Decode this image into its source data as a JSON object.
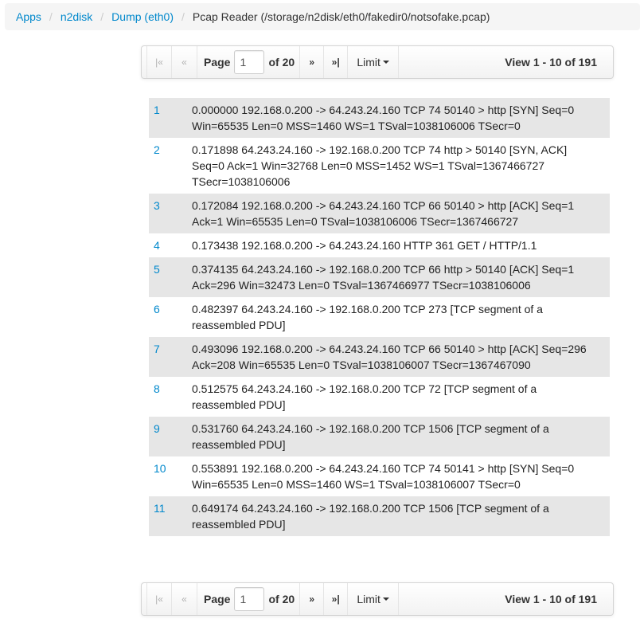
{
  "breadcrumb": {
    "items": [
      "Apps",
      "n2disk",
      "Dump (eth0)"
    ],
    "separator": "/",
    "current": "Pcap Reader (/storage/n2disk/eth0/fakedir0/notsofake.pcap)"
  },
  "pager": {
    "first_label": "|«",
    "prev_label": "«",
    "page_label": "Page",
    "page_value": "1",
    "of_label": "of 20",
    "next_label": "»",
    "last_label": "»|",
    "limit_label": "Limit",
    "view_label": "View 1 - 10 of 191"
  },
  "packets": [
    {
      "num": "1",
      "text": "0.000000 192.168.0.200 -> 64.243.24.160 TCP 74 50140 > http [SYN] Seq=0 Win=65535 Len=0 MSS=1460 WS=1 TSval=1038106006 TSecr=0"
    },
    {
      "num": "2",
      "text": "0.171898 64.243.24.160 -> 192.168.0.200 TCP 74 http > 50140 [SYN, ACK] Seq=0 Ack=1 Win=32768 Len=0 MSS=1452 WS=1 TSval=1367466727 TSecr=1038106006"
    },
    {
      "num": "3",
      "text": "0.172084 192.168.0.200 -> 64.243.24.160 TCP 66 50140 > http [ACK] Seq=1 Ack=1 Win=65535 Len=0 TSval=1038106006 TSecr=1367466727"
    },
    {
      "num": "4",
      "text": "0.173438 192.168.0.200 -> 64.243.24.160 HTTP 361 GET / HTTP/1.1"
    },
    {
      "num": "5",
      "text": "0.374135 64.243.24.160 -> 192.168.0.200 TCP 66 http > 50140 [ACK] Seq=1 Ack=296 Win=32473 Len=0 TSval=1367466977 TSecr=1038106006"
    },
    {
      "num": "6",
      "text": "0.482397 64.243.24.160 -> 192.168.0.200 TCP 273 [TCP segment of a reassembled PDU]"
    },
    {
      "num": "7",
      "text": "0.493096 192.168.0.200 -> 64.243.24.160 TCP 66 50140 > http [ACK] Seq=296 Ack=208 Win=65535 Len=0 TSval=1038106007 TSecr=1367467090"
    },
    {
      "num": "8",
      "text": "0.512575 64.243.24.160 -> 192.168.0.200 TCP 72 [TCP segment of a reassembled PDU]"
    },
    {
      "num": "9",
      "text": "0.531760 64.243.24.160 -> 192.168.0.200 TCP 1506 [TCP segment of a reassembled PDU]"
    },
    {
      "num": "10",
      "text": "0.553891 192.168.0.200 -> 64.243.24.160 TCP 74 50141 > http [SYN] Seq=0 Win=65535 Len=0 MSS=1460 WS=1 TSval=1038106007 TSecr=0"
    },
    {
      "num": "11",
      "text": "0.649174 64.243.24.160 -> 192.168.0.200 TCP 1506 [TCP segment of a reassembled PDU]"
    }
  ]
}
